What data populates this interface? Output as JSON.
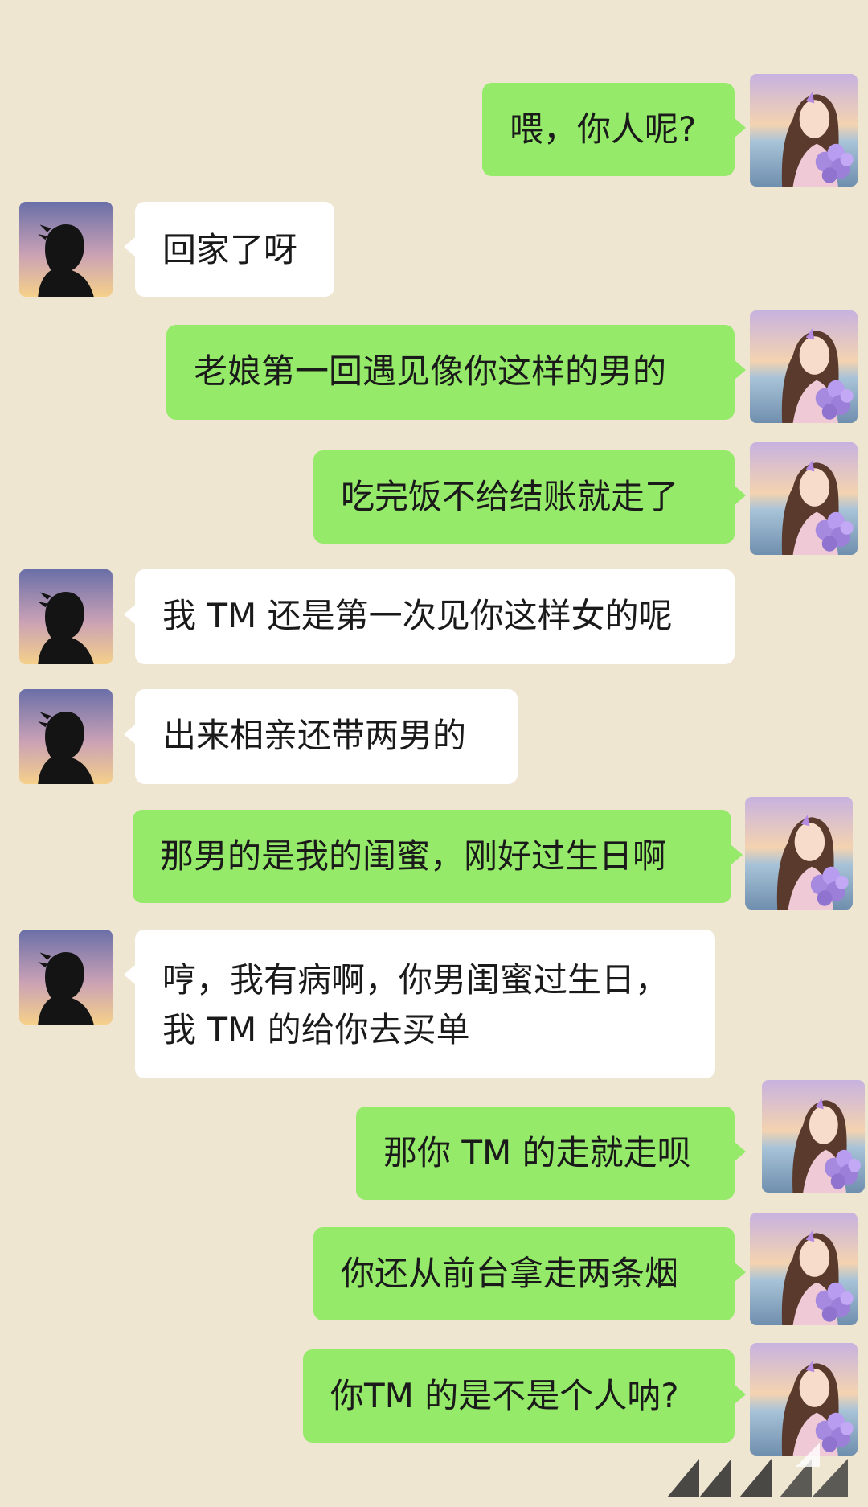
{
  "messages": [
    {
      "sender": "self",
      "lines": [
        "喂，你人呢?"
      ]
    },
    {
      "sender": "other",
      "lines": [
        "回家了呀"
      ]
    },
    {
      "sender": "self",
      "lines": [
        "老娘第一回遇见像你这样的男的"
      ]
    },
    {
      "sender": "self",
      "lines": [
        "吃完饭不给结账就走了"
      ]
    },
    {
      "sender": "other",
      "lines": [
        "我 TM 还是第一次见你这样女的呢"
      ]
    },
    {
      "sender": "other",
      "lines": [
        "出来相亲还带两男的"
      ]
    },
    {
      "sender": "self",
      "lines": [
        "那男的是我的闺蜜，刚好过生日啊"
      ]
    },
    {
      "sender": "other",
      "lines": [
        "哼，我有病啊，你男闺蜜过生日，",
        "我 TM 的给你去买单"
      ]
    },
    {
      "sender": "self",
      "lines": [
        "那你 TM 的走就走呗"
      ]
    },
    {
      "sender": "self",
      "lines": [
        "你还从前台拿走两条烟"
      ]
    },
    {
      "sender": "self",
      "lines": [
        "你TM 的是不是个人呐?"
      ]
    }
  ],
  "colors": {
    "background": "#efe6d2",
    "self_bubble": "#95ea6a",
    "other_bubble": "#ffffff",
    "text": "#1a1a1a"
  },
  "icons": {
    "self_avatar": "girl-with-flowers-avatar-icon",
    "other_avatar": "man-silhouette-avatar-icon",
    "watermark": "triangle-watermark-icon"
  }
}
